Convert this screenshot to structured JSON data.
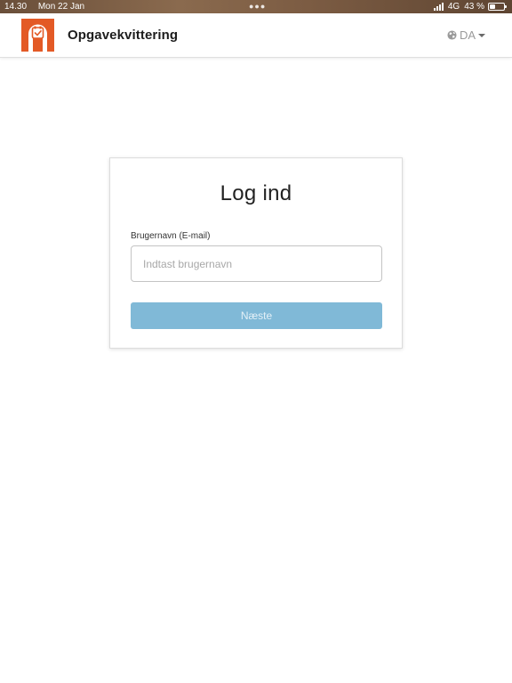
{
  "status_bar": {
    "time": "14.30",
    "date": "Mon 22 Jan",
    "network": "4G",
    "battery_percent": "43 %",
    "battery_level": 0.43
  },
  "header": {
    "app_title": "Opgavekvittering",
    "language": "DA",
    "brand_color": "#e35a26"
  },
  "login": {
    "title": "Log ind",
    "username_label": "Brugernavn (E-mail)",
    "username_value": "",
    "username_placeholder": "Indtast brugernavn",
    "next_label": "Næste",
    "next_color": "#80b9d7"
  }
}
